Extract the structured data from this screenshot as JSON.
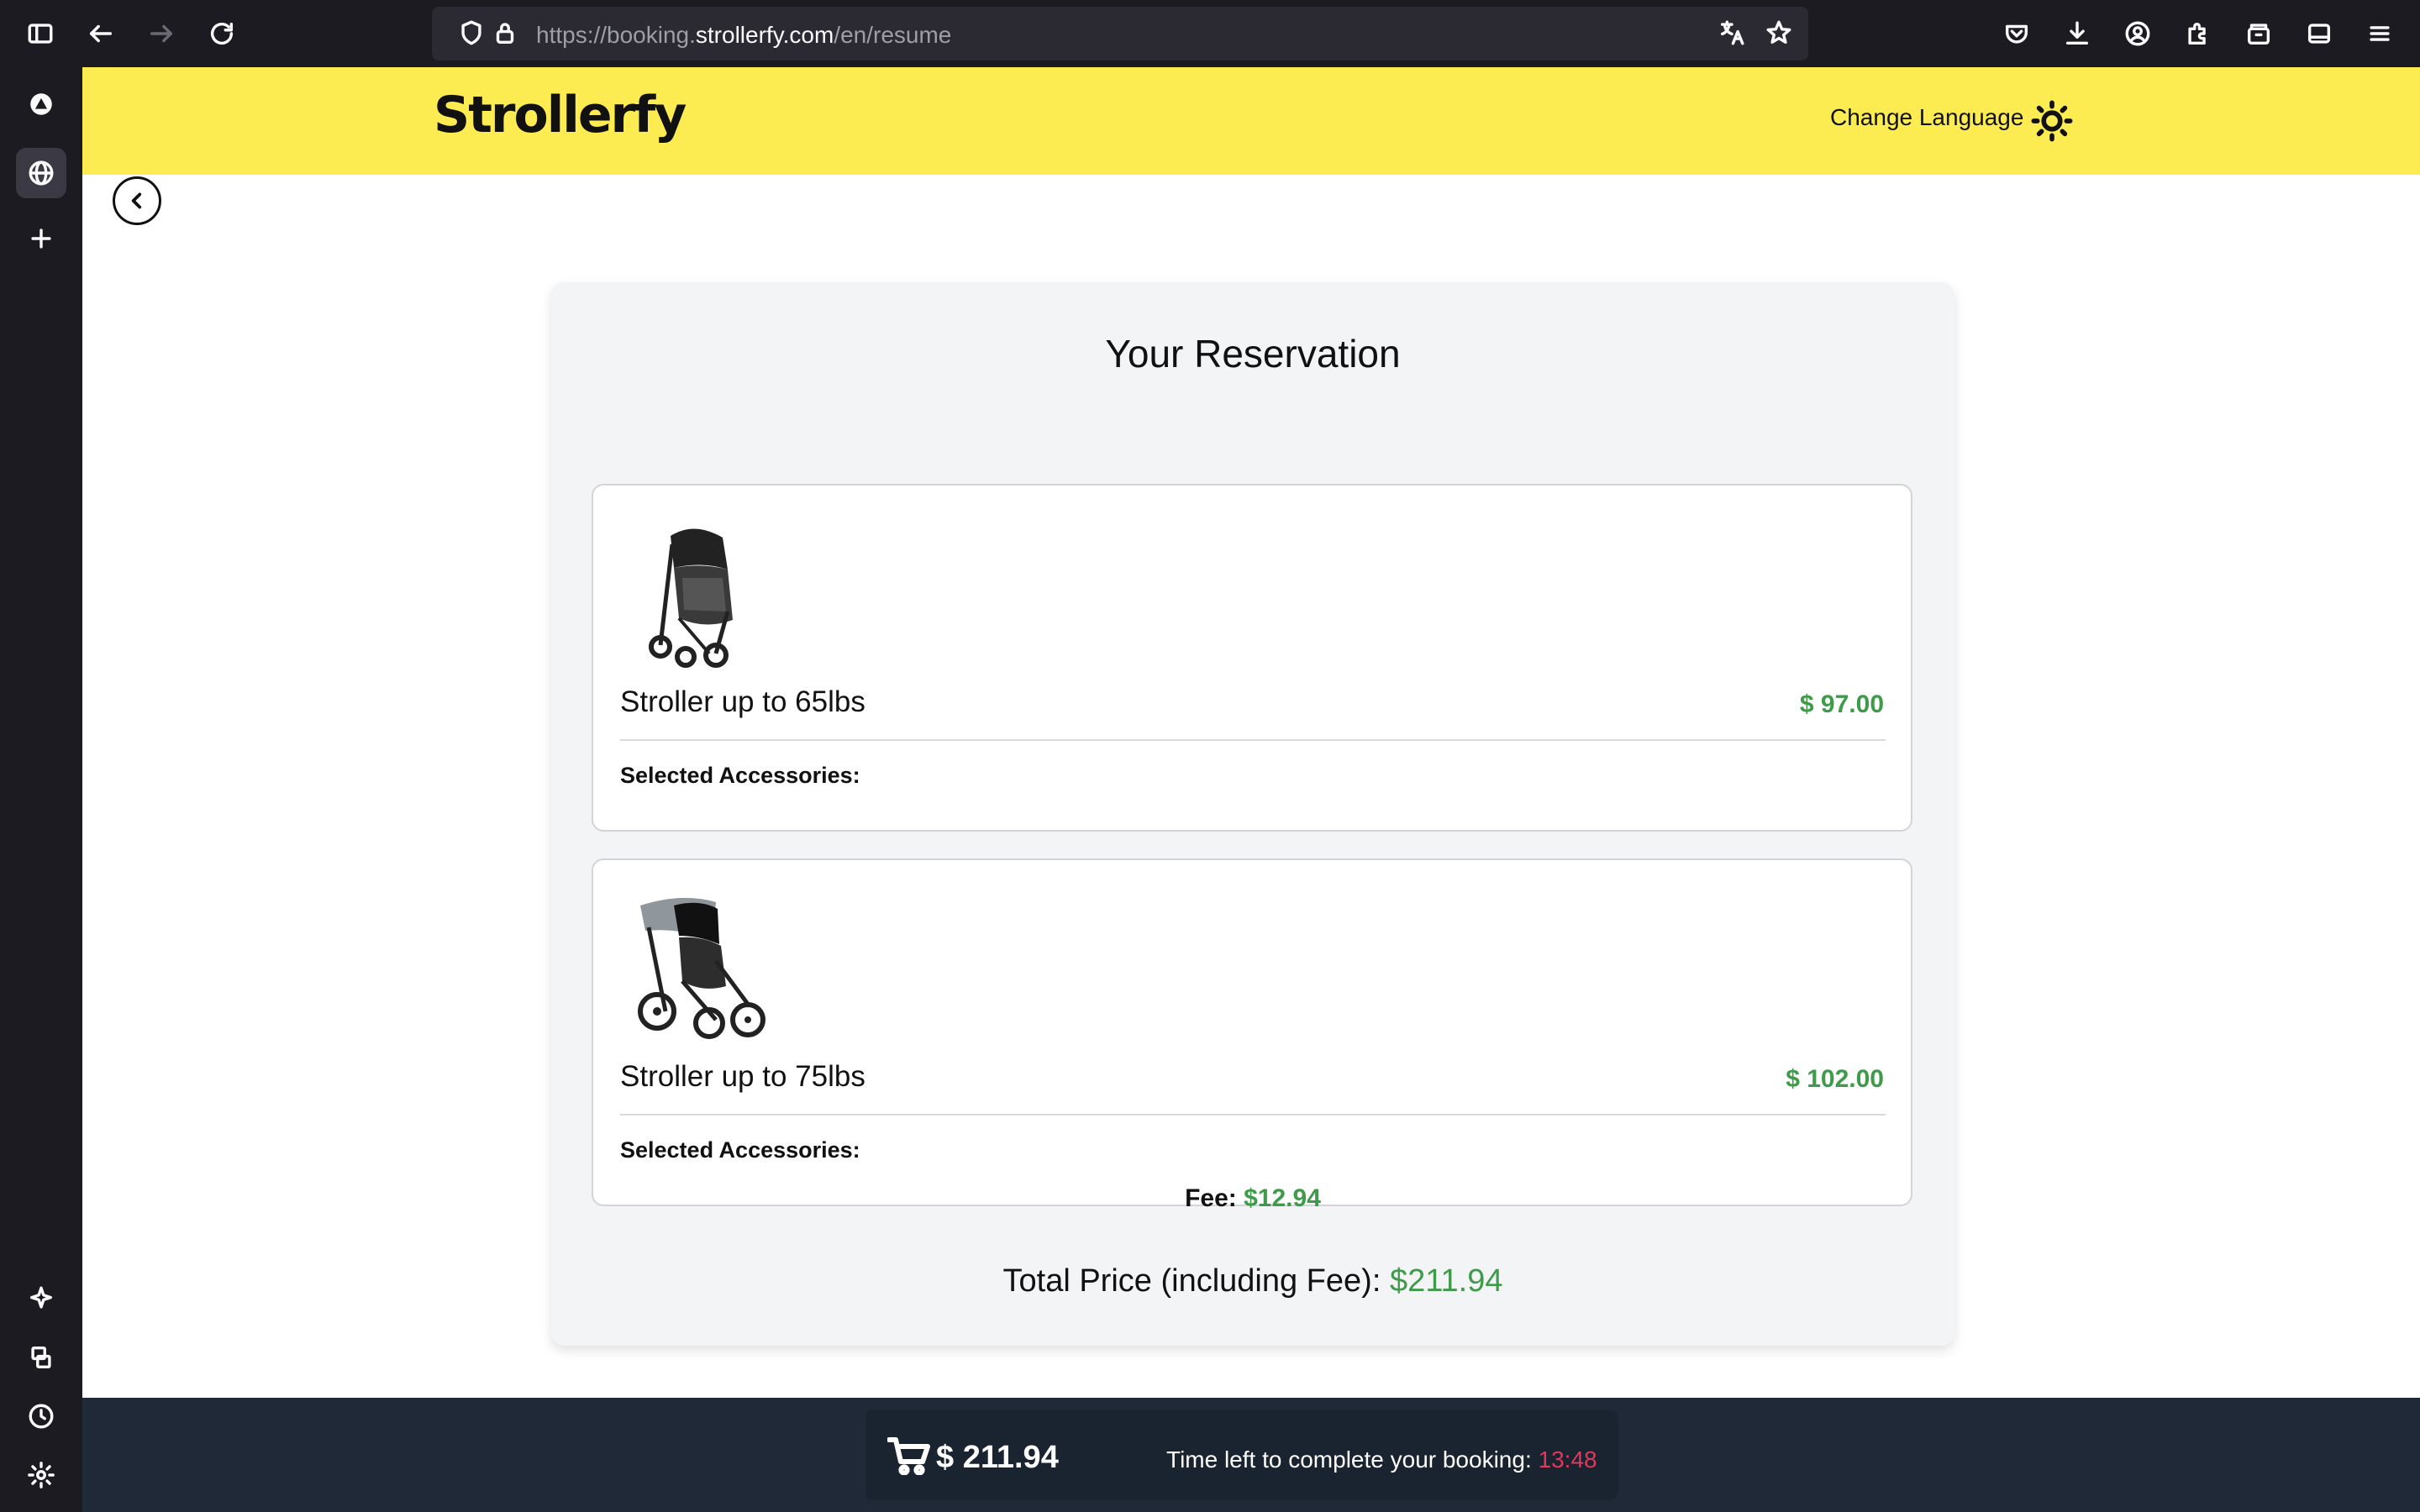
{
  "browser": {
    "url_prefix": "https://booking.",
    "url_domain": "strollerfy.com",
    "url_path": "/en/resume"
  },
  "header": {
    "logo": "Strollerfy",
    "change_language": "Change Language"
  },
  "reservation": {
    "title": "Your Reservation",
    "items": [
      {
        "name": "Stroller up to 65lbs",
        "price": "$ 97.00",
        "accessories_label": "Selected Accessories:"
      },
      {
        "name": "Stroller up to 75lbs",
        "price": "$ 102.00",
        "accessories_label": "Selected Accessories:"
      }
    ],
    "fee_label": "Fee:",
    "fee_value": "$12.94",
    "total_label": "Total Price (including Fee):",
    "total_value": "$211.94"
  },
  "footer": {
    "cart_total": "$ 211.94",
    "timer_label": "Time left to complete your booking:",
    "timer_value": "13:48"
  },
  "colors": {
    "brand_yellow": "#fcec52",
    "price_green": "#3f9a4a",
    "timer_red": "#e0395b",
    "footer_bg": "#1f2937"
  }
}
